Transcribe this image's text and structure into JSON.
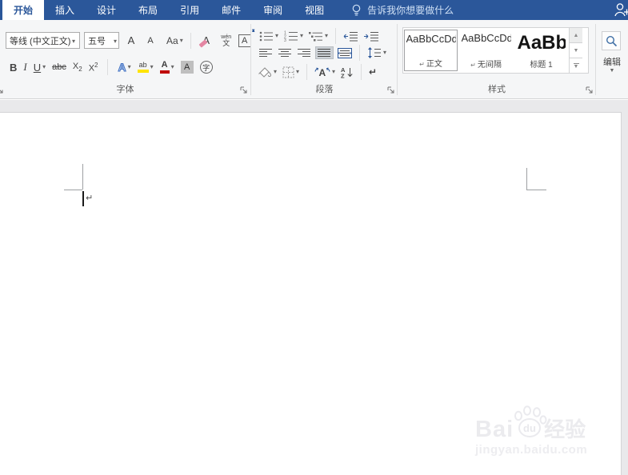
{
  "tab_bar": {
    "tabs": [
      {
        "label": "开始",
        "active": true
      },
      {
        "label": "插入"
      },
      {
        "label": "设计"
      },
      {
        "label": "布局"
      },
      {
        "label": "引用"
      },
      {
        "label": "邮件"
      },
      {
        "label": "审阅"
      },
      {
        "label": "视图"
      }
    ],
    "tell_me": "告诉我你想要做什么"
  },
  "font_group": {
    "label": "字体",
    "font_name_value": "等线 (中文正文)",
    "font_size_value": "五号",
    "grow_font": "A",
    "shrink_font": "A",
    "change_case": "Aa",
    "clear_format": "A",
    "phonetic_top": "wén",
    "phonetic_bottom": "文",
    "char_border": "A",
    "bold": "B",
    "italic": "I",
    "underline": "U",
    "strikethrough": "abc",
    "subscript_base": "X",
    "subscript_script": "2",
    "superscript_base": "X",
    "superscript_script": "2",
    "text_effects": "A",
    "highlight": "ab",
    "font_color": "A",
    "char_shading": "A",
    "enclose_char": "字"
  },
  "paragraph_group": {
    "label": "段落",
    "sort_top": "A",
    "sort_bottom": "Z",
    "asian_letter": "A",
    "show_hide_mark": "↵"
  },
  "styles_group": {
    "label": "样式",
    "styles": [
      {
        "preview": "AaBbCcDd",
        "marker": "↵",
        "name": "正文",
        "selected": true
      },
      {
        "preview": "AaBbCcDd",
        "marker": "↵",
        "name": "无间隔",
        "selected": false
      },
      {
        "preview": "AaBb",
        "name": "标题 1",
        "selected": false
      }
    ]
  },
  "edit_group": {
    "label": "编辑"
  },
  "document": {
    "paragraph_mark": "↵",
    "watermark": {
      "part1": "Bai",
      "part2": "du",
      "part3": "经验",
      "url": "jingyan.baidu.com"
    }
  },
  "colors": {
    "accent_blue": "#2b579a",
    "highlight_yellow": "#ffe400",
    "font_color_red": "#c00000",
    "ribbon_bg": "#f5f6f7",
    "doc_bg": "#e9e9eb"
  }
}
